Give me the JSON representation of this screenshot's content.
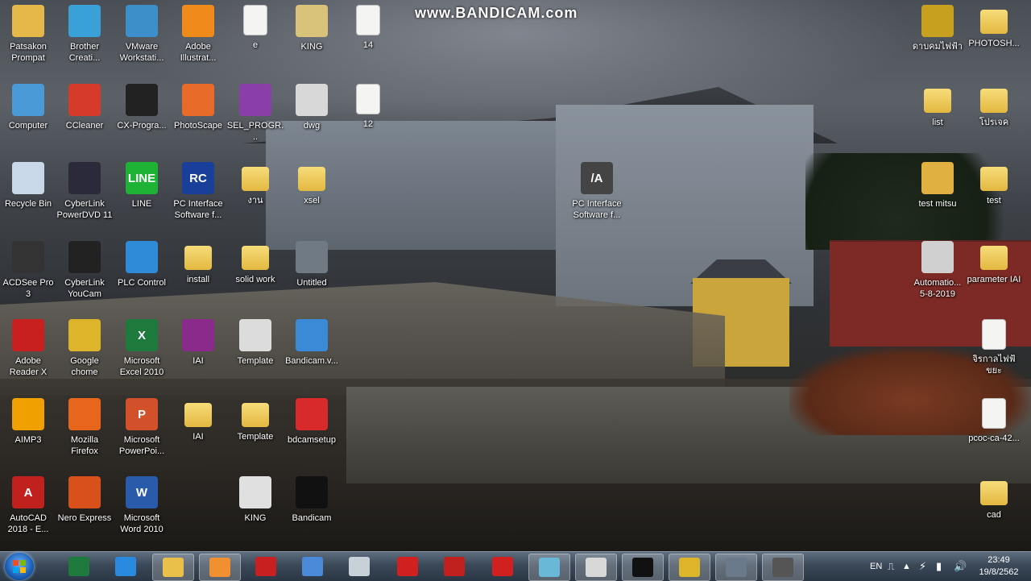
{
  "watermark": "www.BANDICAM.com",
  "desktop_icons": [
    {
      "label": "Patsakon\nPrompat",
      "icon": "user-folder-icon",
      "color": "#e4b94a"
    },
    {
      "label": "Brother\nCreati...",
      "icon": "brother-cube-icon",
      "color": "#3aa0d8"
    },
    {
      "label": "VMware\nWorkstati...",
      "icon": "vmware-icon",
      "color": "#3d8fc9"
    },
    {
      "label": "Adobe\nIllustrat...",
      "icon": "illustrator-icon",
      "color": "#f08a1b",
      "glyph": "Ai"
    },
    {
      "label": "e",
      "icon": "document-icon"
    },
    {
      "label": "KING",
      "icon": "certificate-icon",
      "color": "#d9c27a"
    },
    {
      "label": "14",
      "icon": "document-icon"
    },
    {
      "label": "Computer",
      "icon": "computer-icon",
      "color": "#4b9ad8"
    },
    {
      "label": "CCleaner",
      "icon": "ccleaner-icon",
      "color": "#d63a2b"
    },
    {
      "label": "CX-Progra...",
      "icon": "cx-programmer-icon",
      "color": "#222222"
    },
    {
      "label": "PhotoScape",
      "icon": "photoscape-icon",
      "color": "#e86b2a"
    },
    {
      "label": "SEL_PROGR...",
      "icon": "pdf-document-icon",
      "color": "#8a3fa8"
    },
    {
      "label": "dwg",
      "icon": "dwg-file-icon",
      "color": "#d8d8d8"
    },
    {
      "label": "12",
      "icon": "document-icon"
    },
    {
      "label": "Recycle Bin",
      "icon": "recycle-bin-icon",
      "color": "#c8d8e8"
    },
    {
      "label": "CyberLink\nPowerDVD 11",
      "icon": "powerdvd-icon",
      "color": "#2a2a3a"
    },
    {
      "label": "LINE",
      "icon": "line-app-icon",
      "color": "#1fb336",
      "glyph": "LINE"
    },
    {
      "label": "PC Interface\nSoftware f...",
      "icon": "pc-interface-icon",
      "color": "#1a3f9a",
      "glyph": "RC"
    },
    {
      "label": "งาน",
      "icon": "folder-icon"
    },
    {
      "label": "xsel",
      "icon": "folder-icon"
    },
    {
      "label": "PC Interface\nSoftware f...",
      "icon": "mitsubishi-logo-icon",
      "color": "#444444",
      "glyph": "/A"
    },
    {
      "label": "ACDSee Pro\n3",
      "icon": "acdsee-icon",
      "color": "#333333"
    },
    {
      "label": "CyberLink\nYouCam",
      "icon": "youcam-icon",
      "color": "#222222"
    },
    {
      "label": "PLC Control",
      "icon": "plc-control-icon",
      "color": "#2f8bd8"
    },
    {
      "label": "install",
      "icon": "folder-icon"
    },
    {
      "label": "solid work",
      "icon": "folder-icon"
    },
    {
      "label": "Untitled",
      "icon": "image-file-icon",
      "color": "#6f7a84"
    },
    {
      "label": "Adobe\nReader X",
      "icon": "adobe-reader-icon",
      "color": "#c8201e"
    },
    {
      "label": "Google\nchome",
      "icon": "chrome-icon",
      "color": "#ddb52a"
    },
    {
      "label": "Microsoft\nExcel 2010",
      "icon": "excel-icon",
      "color": "#1e7a3c",
      "glyph": "X"
    },
    {
      "label": "IAI",
      "icon": "winrar-icon",
      "color": "#8a2a8a"
    },
    {
      "label": "Template",
      "icon": "solidworks-file-icon",
      "color": "#dcdcdc"
    },
    {
      "label": "Bandicam.v...",
      "icon": "installer-icon",
      "color": "#3a8ad8"
    },
    {
      "label": "AIMP3",
      "icon": "aimp-icon",
      "color": "#f0a000"
    },
    {
      "label": "Mozilla\nFirefox",
      "icon": "firefox-icon",
      "color": "#e8661c"
    },
    {
      "label": "Microsoft\nPowerPoi...",
      "icon": "powerpoint-icon",
      "color": "#d2502a",
      "glyph": "P"
    },
    {
      "label": "IAI",
      "icon": "folder-icon"
    },
    {
      "label": "Template",
      "icon": "folder-icon"
    },
    {
      "label": "bdcamsetup",
      "icon": "bandicam-setup-icon",
      "color": "#d82a2a"
    },
    {
      "label": "AutoCAD\n2018 - E...",
      "icon": "autocad-icon",
      "color": "#c0201e",
      "glyph": "A"
    },
    {
      "label": "Nero Express",
      "icon": "nero-icon",
      "color": "#d8501a"
    },
    {
      "label": "Microsoft\nWord 2010",
      "icon": "word-icon",
      "color": "#2a5aaa",
      "glyph": "W"
    },
    {
      "label": "KING",
      "icon": "solidworks-part-icon",
      "color": "#e0e0e0"
    },
    {
      "label": "Bandicam",
      "icon": "bandicam-record-icon",
      "color": "#111111"
    },
    {
      "label": "ดาบคมไฟฟ้า",
      "icon": "keys-icon",
      "color": "#c8a020"
    },
    {
      "label": "PHOTOSH...",
      "icon": "folder-icon"
    },
    {
      "label": "list",
      "icon": "folder-icon"
    },
    {
      "label": "โปรเจค",
      "icon": "folder-icon"
    },
    {
      "label": "test mitsu",
      "icon": "pdf-folder-icon",
      "color": "#e0b040"
    },
    {
      "label": "test",
      "icon": "folder-icon"
    },
    {
      "label": "Automatio...\n5-8-2019",
      "icon": "pdf-document-icon",
      "color": "#d0d0d0"
    },
    {
      "label": "parameter IAI",
      "icon": "folder-icon"
    },
    {
      "label": "จิรกาลไฟฟ้\nขยะ",
      "icon": "document-icon"
    },
    {
      "label": "pcoc-ca-42...",
      "icon": "document-icon"
    },
    {
      "label": "cad",
      "icon": "folder-icon"
    }
  ],
  "taskbar": {
    "apps": [
      {
        "icon": "excel-task-icon",
        "color": "#1e7a3c"
      },
      {
        "icon": "internet-explorer-icon",
        "color": "#2a8ae0"
      },
      {
        "icon": "file-explorer-icon",
        "color": "#e8c04a"
      },
      {
        "icon": "media-player-icon",
        "color": "#f09030"
      },
      {
        "icon": "cx-one-icon",
        "color": "#c82020"
      },
      {
        "icon": "pc-monitor-icon",
        "color": "#4a8ad8"
      },
      {
        "icon": "calculator-icon",
        "color": "#c8d0d8"
      },
      {
        "icon": "app-red-icon",
        "color": "#d02020"
      },
      {
        "icon": "autocad-task-icon",
        "color": "#c0201e"
      },
      {
        "icon": "solidworks-2017-icon",
        "color": "#d02020"
      },
      {
        "icon": "sketch-app-icon",
        "color": "#6ab8d8"
      },
      {
        "icon": "paint-icon",
        "color": "#d8d8d8"
      },
      {
        "icon": "bandicam-task-icon",
        "color": "#111111"
      },
      {
        "icon": "chrome-task-icon",
        "color": "#ddb52a"
      },
      {
        "icon": "camera-app-icon",
        "color": "#6a7a8a"
      },
      {
        "icon": "mitsubishi-task-icon",
        "color": "#555555"
      }
    ],
    "language": "EN",
    "time": "23:49",
    "date": "19/8/2562"
  }
}
